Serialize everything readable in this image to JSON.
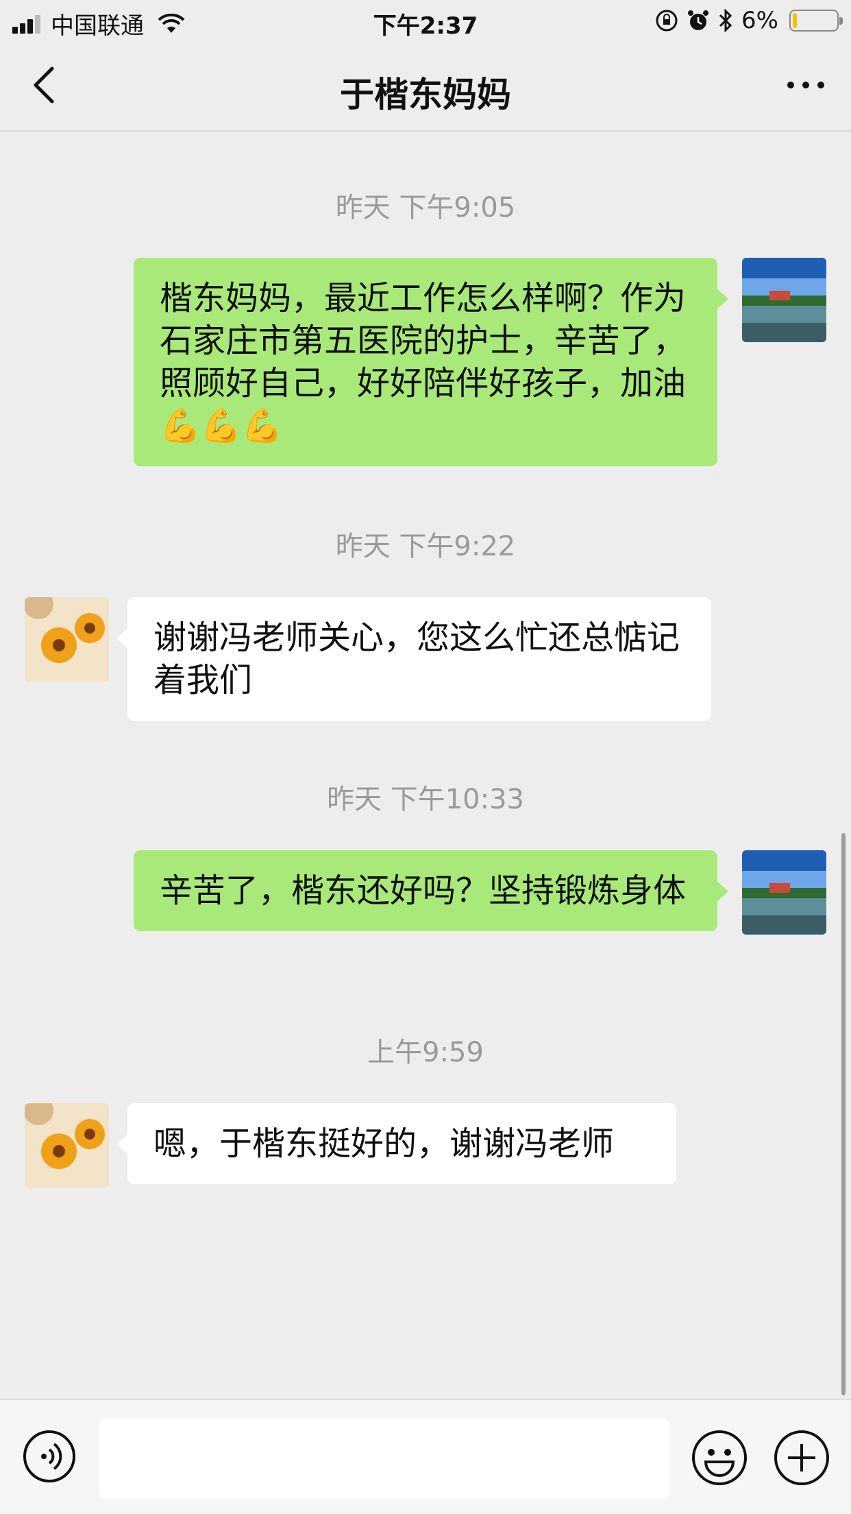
{
  "status_bar": {
    "carrier": "中国联通",
    "time": "下午2:37",
    "battery": "6%",
    "battery_level": 0.06,
    "icons": [
      "signal-icon",
      "wifi-icon",
      "rotation-lock-icon",
      "alarm-icon",
      "bluetooth-icon",
      "battery-icon"
    ]
  },
  "nav": {
    "title": "于楷东妈妈",
    "icons": [
      "back-arrow-icon",
      "more-icon"
    ]
  },
  "messages": [
    {
      "timestamp": "昨天 下午9:05",
      "direction": "out",
      "text": "楷东妈妈，最近工作怎么样啊？作为石家庄市第五医院的护士，辛苦了，照顾好自己，好好陪伴好孩子，加油💪💪💪"
    },
    {
      "timestamp": "昨天 下午9:22",
      "direction": "in",
      "text": "谢谢冯老师关心，您这么忙还总惦记着我们"
    },
    {
      "timestamp": "昨天 下午10:33",
      "direction": "out",
      "text": "辛苦了，楷东还好吗？坚持锻炼身体"
    },
    {
      "timestamp": "上午9:59",
      "direction": "in",
      "text": "嗯，于楷东挺好的，谢谢冯老师"
    }
  ],
  "input_bar": {
    "placeholder": "",
    "icons": [
      "voice-icon",
      "emoji-icon",
      "plus-icon"
    ]
  },
  "colors": {
    "background": "#ededed",
    "outgoing_bubble": "#a9e97a",
    "incoming_bubble": "#ffffff",
    "timestamp_text": "#9a9a9a"
  }
}
